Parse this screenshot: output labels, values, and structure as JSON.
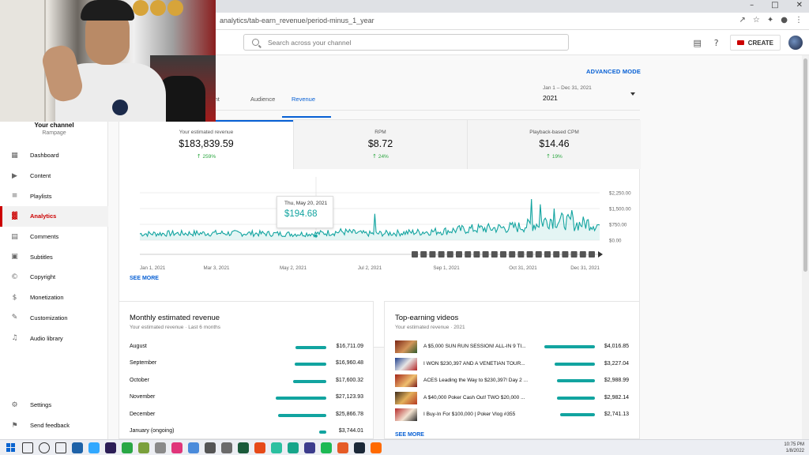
{
  "browser": {
    "url": "analytics/tab-earn_revenue/period-minus_1_year",
    "window_controls": [
      "–",
      "□",
      "✕"
    ]
  },
  "header": {
    "search_placeholder": "Search across your channel",
    "create_label": "CREATE"
  },
  "sidebar": {
    "channel_title": "Your channel",
    "channel_handle": "Rampage",
    "items": [
      {
        "label": "Dashboard",
        "icon": "dashboard-icon",
        "glyph": "▦"
      },
      {
        "label": "Content",
        "icon": "content-icon",
        "glyph": "▶"
      },
      {
        "label": "Playlists",
        "icon": "playlists-icon",
        "glyph": "≡"
      },
      {
        "label": "Analytics",
        "icon": "analytics-icon",
        "glyph": "▓",
        "active": true
      },
      {
        "label": "Comments",
        "icon": "comments-icon",
        "glyph": "▤"
      },
      {
        "label": "Subtitles",
        "icon": "subtitles-icon",
        "glyph": "▣"
      },
      {
        "label": "Copyright",
        "icon": "copyright-icon",
        "glyph": "©"
      },
      {
        "label": "Monetization",
        "icon": "monetization-icon",
        "glyph": "$"
      },
      {
        "label": "Customization",
        "icon": "customization-icon",
        "glyph": "✎"
      },
      {
        "label": "Audio library",
        "icon": "audio-library-icon",
        "glyph": "♫"
      }
    ],
    "bottom_items": [
      {
        "label": "Settings",
        "icon": "settings-icon",
        "glyph": "⚙"
      },
      {
        "label": "Send feedback",
        "icon": "feedback-icon",
        "glyph": "⚑"
      }
    ]
  },
  "analytics": {
    "advanced_mode": "ADVANCED MODE",
    "tabs": [
      "ement",
      "Audience",
      "Revenue"
    ],
    "active_tab": 2,
    "date_range_sub": "Jan 1 – Dec 31, 2021",
    "date_range_value": "2021",
    "metrics": [
      {
        "label": "Your estimated revenue",
        "value": "$183,839.59",
        "delta": "259%"
      },
      {
        "label": "RPM",
        "value": "$8.72",
        "delta": "24%"
      },
      {
        "label": "Playback-based CPM",
        "value": "$14.46",
        "delta": "19%"
      }
    ],
    "tooltip": {
      "date": "Thu, May 20, 2021",
      "value": "$194.68"
    },
    "see_more": "SEE MORE"
  },
  "chart_data": {
    "type": "line",
    "series": [
      {
        "name": "",
        "seed_daily_revenue": true
      }
    ],
    "x_tick_labels": [
      "Jan 1, 2021",
      "Mar 3, 2021",
      "May 2, 2021",
      "Jul 2, 2021",
      "Sep 1, 2021",
      "Oct 31, 2021",
      "Dec 31, 2021"
    ],
    "y_tick_labels": [
      "$2,250.00",
      "$1,500.00",
      "$750.00",
      "$0.00"
    ],
    "ylim": [
      0,
      2250
    ],
    "x_days": 365,
    "profile": [
      [
        0,
        300
      ],
      [
        30,
        320
      ],
      [
        60,
        330
      ],
      [
        90,
        320
      ],
      [
        120,
        290
      ],
      [
        140,
        310
      ],
      [
        160,
        400
      ],
      [
        180,
        300
      ],
      [
        200,
        330
      ],
      [
        220,
        380
      ],
      [
        240,
        430
      ],
      [
        260,
        520
      ],
      [
        280,
        560
      ],
      [
        300,
        620
      ],
      [
        315,
        780
      ],
      [
        325,
        1000
      ],
      [
        335,
        900
      ],
      [
        345,
        750
      ],
      [
        355,
        820
      ],
      [
        364,
        700
      ]
    ],
    "spikes": [
      [
        186,
        1250
      ],
      [
        310,
        1950
      ],
      [
        317,
        1700
      ],
      [
        328,
        1500
      ],
      [
        342,
        1420
      ]
    ],
    "line_color": "#12a4a0",
    "grid": true,
    "event_markers": 21
  },
  "monthly": {
    "title": "Monthly estimated revenue",
    "subtitle": "Your estimated revenue · Last 6 months",
    "rows": [
      {
        "month": "August",
        "amount": "$16,711.09",
        "value": 16711.09
      },
      {
        "month": "September",
        "amount": "$16,960.48",
        "value": 16960.48
      },
      {
        "month": "October",
        "amount": "$17,600.32",
        "value": 17600.32
      },
      {
        "month": "November",
        "amount": "$27,123.93",
        "value": 27123.93
      },
      {
        "month": "December",
        "amount": "$25,866.78",
        "value": 25866.78
      },
      {
        "month": "January (ongoing)",
        "amount": "$3,744.01",
        "value": 3744.01
      }
    ]
  },
  "top_videos": {
    "title": "Top-earning videos",
    "subtitle": "Your estimated revenue · 2021",
    "rows": [
      {
        "title": "A $5,000 SUN RUN SESSION! ALL-IN 9 TI...",
        "amount": "$4,016.85",
        "value": 4016.85
      },
      {
        "title": "I WON $230,397 AND A VENETIAN TOUR...",
        "amount": "$3,227.04",
        "value": 3227.04
      },
      {
        "title": "ACES Leading the Way to $230,397! Day 2 ...",
        "amount": "$2,988.99",
        "value": 2988.99
      },
      {
        "title": "A $40,000 Poker Cash Out! TWO $20,000 ...",
        "amount": "$2,982.14",
        "value": 2982.14
      },
      {
        "title": "I Buy-In For $100,000 | Poker Vlog #355",
        "amount": "$2,741.13",
        "value": 2741.13
      }
    ],
    "see_more": "SEE MORE"
  },
  "taskbar": {
    "time": "10:75 PM",
    "date": "1/8/2022",
    "apps": [
      "#e44b3a",
      "#f2b31b",
      "#1a73e8",
      "#1e62a8",
      "#31a8ff",
      "#2c1e56",
      "#29a745",
      "#7aa03c",
      "#8a8a8a",
      "#e0357a",
      "#4a8bdb",
      "#555",
      "#6b6b6b",
      "#1a5a3a",
      "#e64a19",
      "#2bc0a0",
      "#17a58a",
      "#3c3c8c",
      "#1db954",
      "#e55b26",
      "#1b2838",
      "#ff6a00"
    ]
  }
}
